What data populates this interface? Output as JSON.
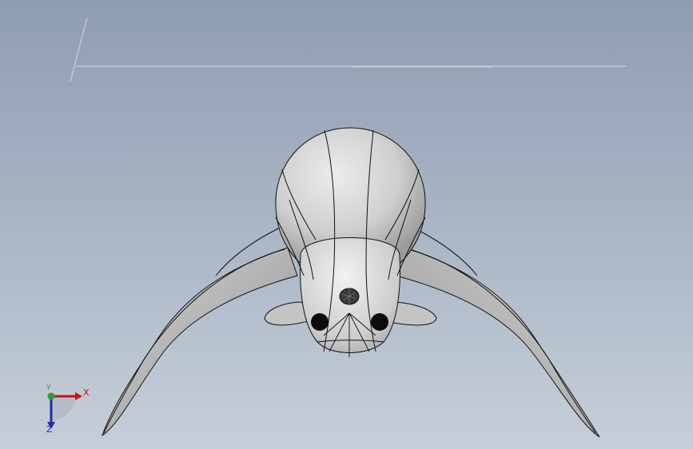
{
  "viewport": {
    "background_top": "#8f9db0",
    "background_bottom": "#c6ced9"
  },
  "model": {
    "body_color": "#c9c9c9",
    "edge_color": "#111111",
    "eye_color": "#0d0d0d"
  },
  "triad": {
    "x_label": "X",
    "y_label": "Y",
    "z_label": "Z",
    "x_color": "#c8101a",
    "y_color": "#2f9a2f",
    "z_color": "#1b2fb0"
  }
}
